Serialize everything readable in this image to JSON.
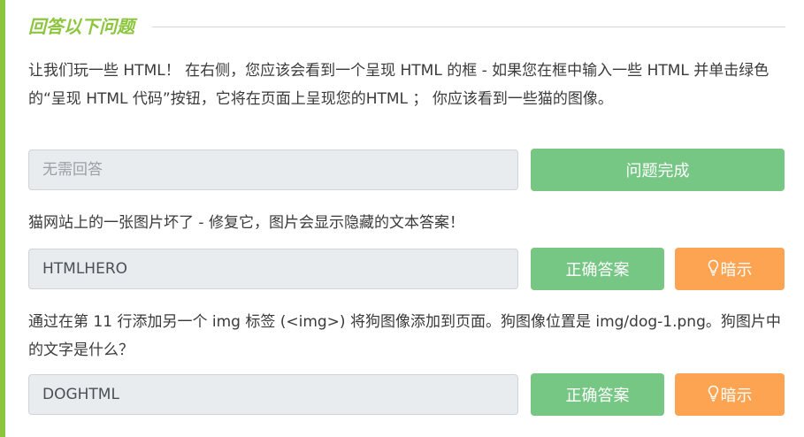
{
  "section": {
    "title": "回答以下问题"
  },
  "questions": [
    {
      "text": "让我们玩一些 HTML！ 在右侧，您应该会看到一个呈现 HTML 的框 - 如果您在框中输入一些 HTML 并单击绿色的“呈现 HTML 代码”按钮，它将在页面上呈现您的HTML ； 你应该看到一些猫的图像。",
      "answer_placeholder": "无需回答",
      "answer_value": "",
      "submit_label": "问题完成"
    },
    {
      "text": "猫网站上的一张图片坏了 - 修复它，图片会显示隐藏的文本答案！",
      "answer_value": "HTMLHERO",
      "submit_label": "正确答案",
      "hint_label": "暗示"
    },
    {
      "text": "通过在第 11 行添加另一个 img 标签 (<img>) 将狗图像添加到页面。狗图像位置是 img/dog-1.png。狗图片中的文字是什么？",
      "answer_value": "DOGHTML",
      "submit_label": "正确答案",
      "hint_label": "暗示"
    }
  ],
  "colors": {
    "accent": "#8cc63f",
    "success": "#76c684",
    "hint": "#fca452",
    "field_bg": "#e9ecef"
  },
  "icons": {
    "hint": "lightbulb-icon"
  }
}
